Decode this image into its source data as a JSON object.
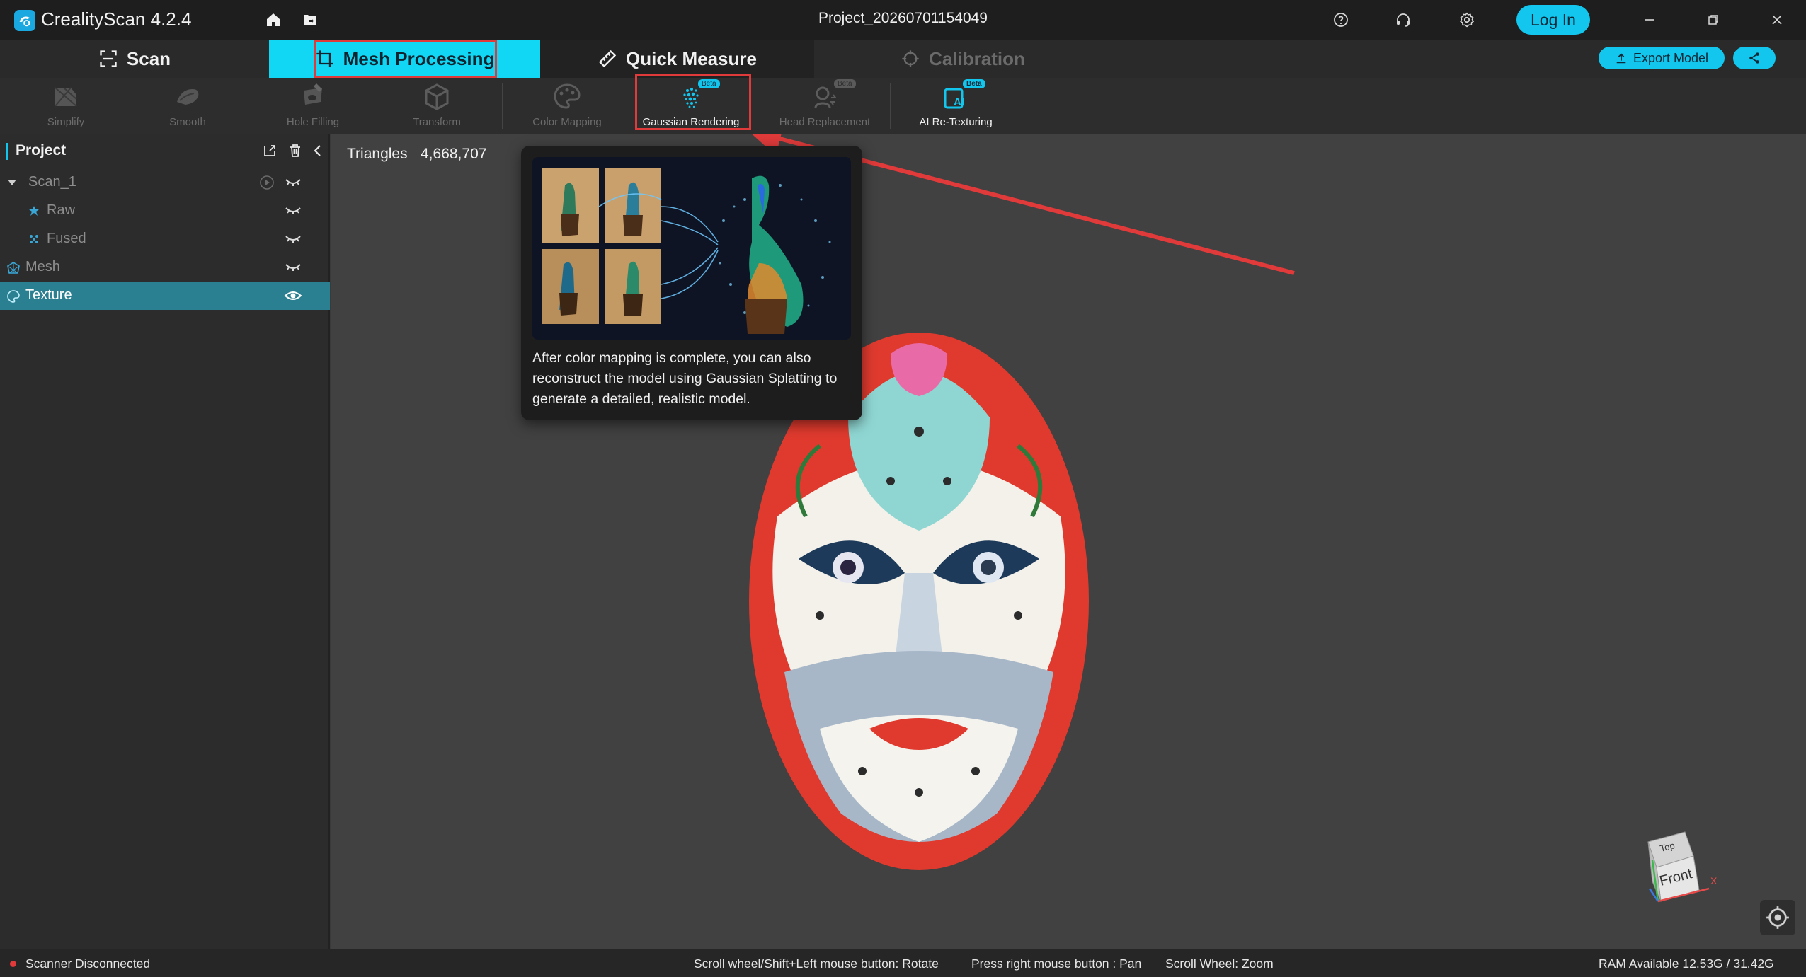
{
  "window": {
    "app_name": "CrealityScan 4.2.4",
    "project_title": "Project_20260701154049",
    "login_label": "Log In"
  },
  "mode_tabs": {
    "scan": "Scan",
    "mesh_processing": "Mesh Processing",
    "quick_measure": "Quick Measure",
    "calibration": "Calibration",
    "active": "Mesh Processing"
  },
  "actions": {
    "export_label": "Export Model"
  },
  "toolbar": {
    "tools": [
      {
        "label": "Simplify",
        "enabled": false,
        "icon": "simplify-icon"
      },
      {
        "label": "Smooth",
        "enabled": false,
        "icon": "smooth-icon"
      },
      {
        "label": "Hole Filling",
        "enabled": false,
        "icon": "hole-filling-icon"
      },
      {
        "label": "Transform",
        "enabled": false,
        "icon": "transform-icon"
      },
      {
        "label": "Color Mapping",
        "enabled": false,
        "icon": "color-mapping-icon"
      },
      {
        "label": "Gaussian Rendering",
        "enabled": true,
        "icon": "gaussian-rendering-icon",
        "badge": "Beta"
      },
      {
        "label": "Head Replacement",
        "enabled": false,
        "icon": "head-replacement-icon",
        "badge": "Beta"
      },
      {
        "label": "AI Re-Texturing",
        "enabled": true,
        "icon": "ai-retexturing-icon",
        "badge": "Beta",
        "icon_text": "AI"
      }
    ]
  },
  "project_panel": {
    "title": "Project",
    "items": [
      {
        "label": "Scan_1",
        "visible": false
      },
      {
        "label": "Raw",
        "visible": false
      },
      {
        "label": "Fused",
        "visible": false
      },
      {
        "label": "Mesh",
        "visible": false
      },
      {
        "label": "Texture",
        "visible": true,
        "selected": true
      }
    ]
  },
  "viewport": {
    "triangles_label": "Triangles",
    "triangles_value": "4,668,707",
    "view_cube": {
      "top": "Top",
      "front": "Front",
      "axis_x": "X"
    }
  },
  "tooltip": {
    "text": "After color mapping is complete, you can also reconstruct the model using Gaussian Splatting to generate a detailed, realistic model."
  },
  "status_bar": {
    "scanner_status": "Scanner Disconnected",
    "hint_rotate": "Scroll wheel/Shift+Left mouse button: Rotate",
    "hint_pan": "Press right mouse button : Pan",
    "hint_zoom": "Scroll Wheel: Zoom",
    "ram": "RAM Available 12.53G / 31.42G"
  },
  "colors": {
    "accent": "#12c6ee",
    "active_tab": "#12d7f4",
    "highlight": "#e03a3a",
    "status_error": "#e23a3a"
  }
}
